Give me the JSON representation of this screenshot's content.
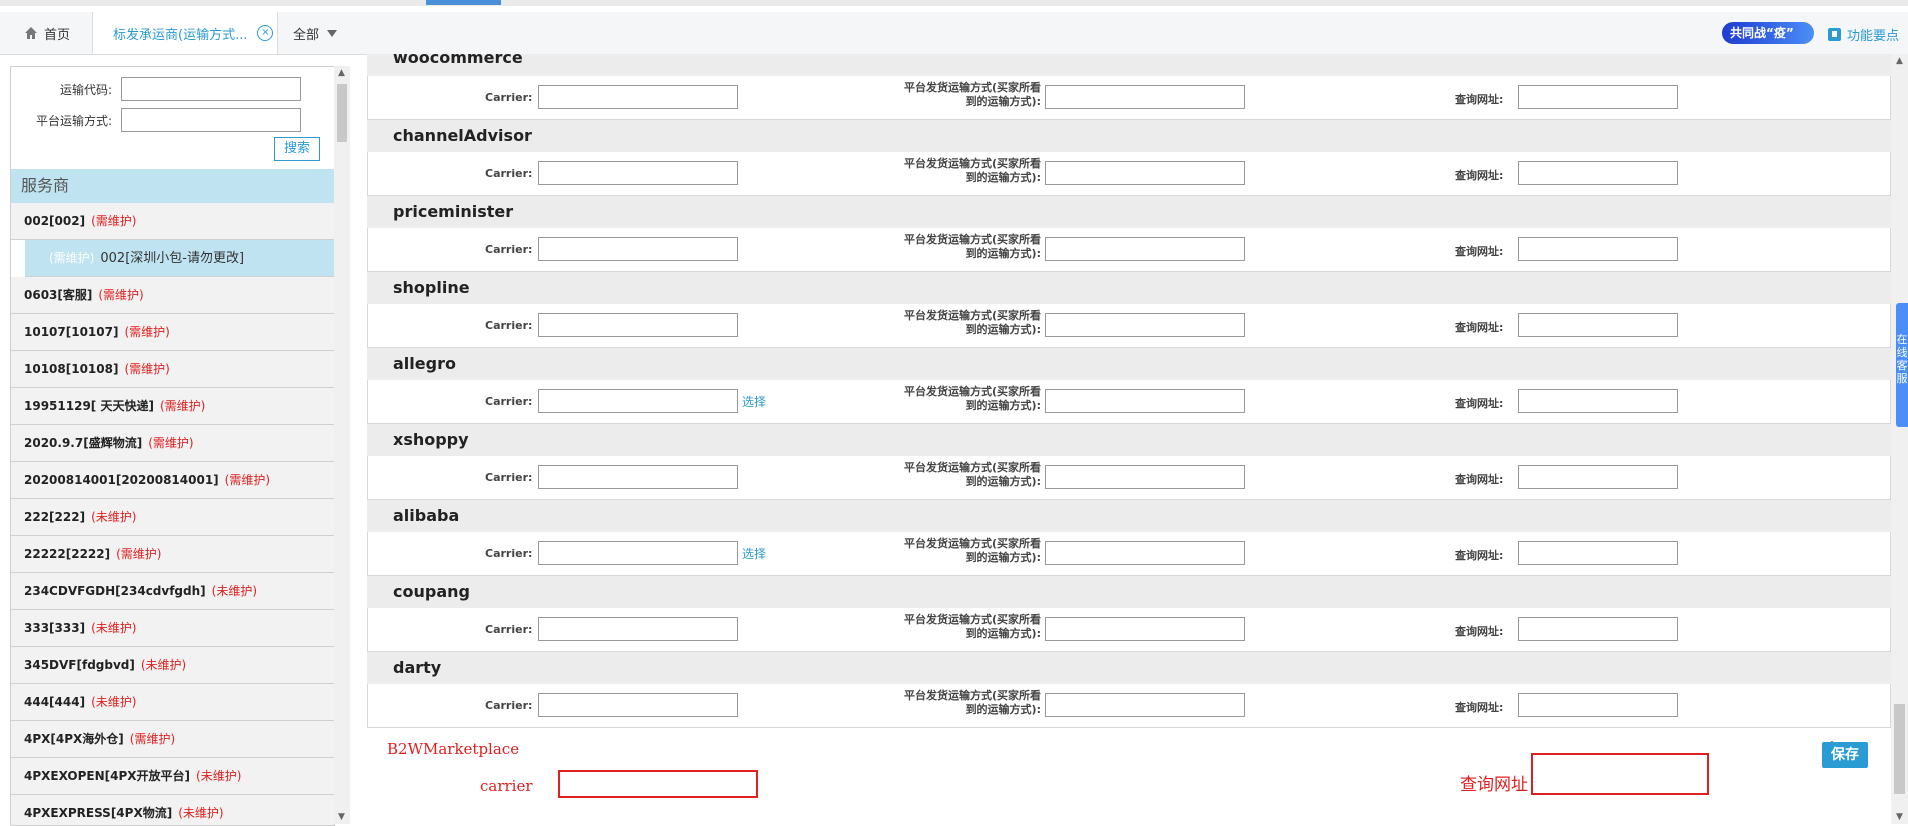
{
  "tabs": {
    "home": "首页",
    "active": "标发承运商(运输方式...",
    "all": "全部"
  },
  "header": {
    "badge": "共同战“疫”",
    "func": "功能要点"
  },
  "filter": {
    "code_label": "运输代码:",
    "code_value": "",
    "platform_label": "平台运输方式:",
    "platform_value": "",
    "search_button": "搜索"
  },
  "sidebar": {
    "title": "服务商",
    "items": [
      {
        "name": "002[002]",
        "status": "(需维护)"
      },
      {
        "name": "0603[客服]",
        "status": "(需维护)"
      },
      {
        "name": "10107[10107]",
        "status": "(需维护)"
      },
      {
        "name": "10108[10108]",
        "status": "(需维护)"
      },
      {
        "name": "19951129[ 天天快递]",
        "status": "(需维护)"
      },
      {
        "name": "2020.9.7[盛辉物流]",
        "status": "(需维护)"
      },
      {
        "name": "20200814001[20200814001]",
        "status": "(需维护)"
      },
      {
        "name": "222[222]",
        "status": "(未维护)"
      },
      {
        "name": "22222[2222]",
        "status": "(需维护)"
      },
      {
        "name": "234CDVFGDH[234cdvfgdh]",
        "status": "(未维护)"
      },
      {
        "name": "333[333]",
        "status": "(未维护)"
      },
      {
        "name": "345DVF[fdgbvd]",
        "status": "(未维护)"
      },
      {
        "name": "444[444]",
        "status": "(未维护)"
      },
      {
        "name": "4PX[4PX海外仓]",
        "status": "(需维护)"
      },
      {
        "name": "4PXEXOPEN[4PX开放平台]",
        "status": "(未维护)"
      },
      {
        "name": "4PXEXPRESS[4PX物流]",
        "status": "(未维护)"
      }
    ],
    "sub": {
      "status": "(需维护)",
      "name": "002[深圳小包-请勿更改]"
    }
  },
  "labels": {
    "carrier": "Carrier:",
    "platform_line1": "平台发货运输方式(买家所看",
    "platform_line2": "到的运输方式):",
    "query": "查询网址:",
    "pick": "选择"
  },
  "sections": [
    {
      "name": "woocommerce",
      "pick": false
    },
    {
      "name": "channelAdvisor",
      "pick": false
    },
    {
      "name": "priceminister",
      "pick": false
    },
    {
      "name": "shopline",
      "pick": false
    },
    {
      "name": "allegro",
      "pick": true
    },
    {
      "name": "xshoppy",
      "pick": false
    },
    {
      "name": "alibaba",
      "pick": true
    },
    {
      "name": "coupang",
      "pick": false
    },
    {
      "name": "darty",
      "pick": false
    }
  ],
  "annotation": {
    "title": "B2WMarketplace",
    "carrier": "carrier",
    "query": "查询网址"
  },
  "save_button": "保存",
  "online_service": "在线客服"
}
